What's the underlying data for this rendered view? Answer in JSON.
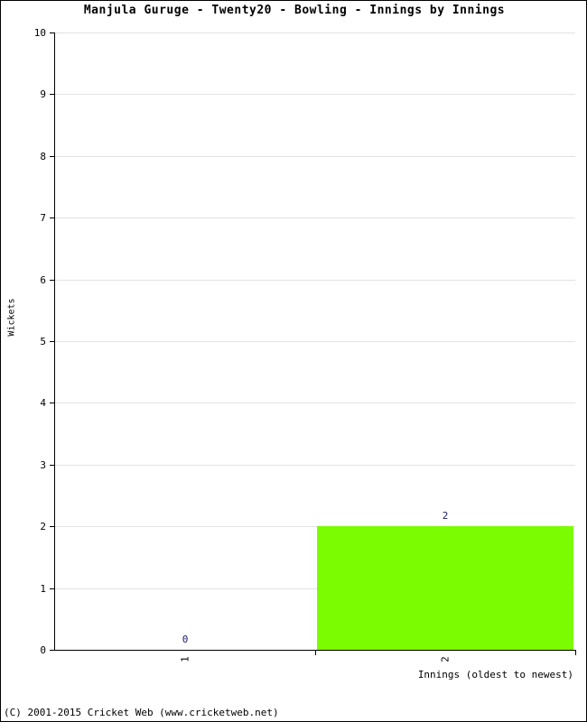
{
  "chart_data": {
    "type": "bar",
    "title": "Manjula Guruge - Twenty20 - Bowling - Innings by Innings",
    "xlabel": "Innings (oldest to newest)",
    "ylabel": "Wickets",
    "categories": [
      "1",
      "2"
    ],
    "values": [
      0,
      2
    ],
    "value_labels": [
      "0",
      "2"
    ],
    "ylim": [
      0,
      10
    ],
    "ytick_labels": [
      "0",
      "1",
      "2",
      "3",
      "4",
      "5",
      "6",
      "7",
      "8",
      "9",
      "10"
    ],
    "ytick_values": [
      0,
      1,
      2,
      3,
      4,
      5,
      6,
      7,
      8,
      9,
      10
    ],
    "grid": true,
    "legend": "none",
    "series": [
      {
        "name": "Wickets",
        "values": [
          0,
          2
        ],
        "color": "#7CFC00"
      }
    ],
    "bar_color": "#7CFC00",
    "value_label_color": "#191970",
    "gridline_color": "#E2E2E2",
    "axis_color": "#000000"
  },
  "footer": {
    "copyright": "(C) 2001-2015 Cricket Web (www.cricketweb.net)"
  }
}
